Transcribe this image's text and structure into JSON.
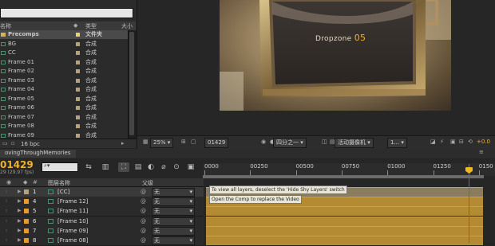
{
  "project": {
    "columns": {
      "name": "名称",
      "type": "类型",
      "size": "大小"
    },
    "items": [
      {
        "name": "Precomps",
        "type": "文件夹",
        "color": "#e8d56a",
        "folder": true,
        "selected": true
      },
      {
        "name": "BG",
        "type": "合成",
        "color": "#b3a27a"
      },
      {
        "name": "CC",
        "type": "合成",
        "color": "#b3a27a"
      },
      {
        "name": "Frame 01",
        "type": "合成",
        "color": "#b3a27a"
      },
      {
        "name": "Frame 02",
        "type": "合成",
        "color": "#b3a27a"
      },
      {
        "name": "Frame 03",
        "type": "合成",
        "color": "#b3a27a"
      },
      {
        "name": "Frame 04",
        "type": "合成",
        "color": "#b3a27a"
      },
      {
        "name": "Frame 05",
        "type": "合成",
        "color": "#b3a27a"
      },
      {
        "name": "Frame 06",
        "type": "合成",
        "color": "#b3a27a"
      },
      {
        "name": "Frame 07",
        "type": "合成",
        "color": "#b3a27a"
      },
      {
        "name": "Frame 08",
        "type": "合成",
        "color": "#b3a27a"
      },
      {
        "name": "Frame 09",
        "type": "合成",
        "color": "#b3a27a"
      }
    ],
    "bpc_label": "16 bpc"
  },
  "viewer": {
    "preview_title": "Dropzone",
    "preview_number": "05",
    "zoom": "25%",
    "timecode": "01429",
    "resolution": "四分之一",
    "camera": "活动摄像机",
    "views": "1...",
    "exposure": "+0.0"
  },
  "timeline": {
    "tab_label": "ovingThroughMemories",
    "timecode": "01429",
    "fps": "29 (29.97 fps)",
    "columns": {
      "source_name": "图层名称",
      "parent": "父级"
    },
    "ruler_ticks": [
      "0000",
      "00250",
      "00500",
      "00750",
      "01000",
      "01250",
      "0150"
    ],
    "layers": [
      {
        "num": "1",
        "name": "[CC]",
        "color": "#b3a27a",
        "parent": "无",
        "selected": true
      },
      {
        "num": "4",
        "name": "[Frame 12]",
        "color": "#e89a2a",
        "parent": "无"
      },
      {
        "num": "5",
        "name": "[Frame 11]",
        "color": "#e89a2a",
        "parent": "无"
      },
      {
        "num": "6",
        "name": "[Frame 10]",
        "color": "#e89a2a",
        "parent": "无"
      },
      {
        "num": "7",
        "name": "[Frame 09]",
        "color": "#e89a2a",
        "parent": "无"
      },
      {
        "num": "8",
        "name": "[Frame 08]",
        "color": "#e89a2a",
        "parent": "无"
      }
    ],
    "tooltips": {
      "shy": "To view all layers, deselect the 'Hide Shy Layers' switch",
      "replace": "Open the Comp to replace the Video"
    }
  },
  "colors": {
    "accent": "#f0b030",
    "playhead": "#e03a2a",
    "layer_bar": "#b48a32"
  }
}
